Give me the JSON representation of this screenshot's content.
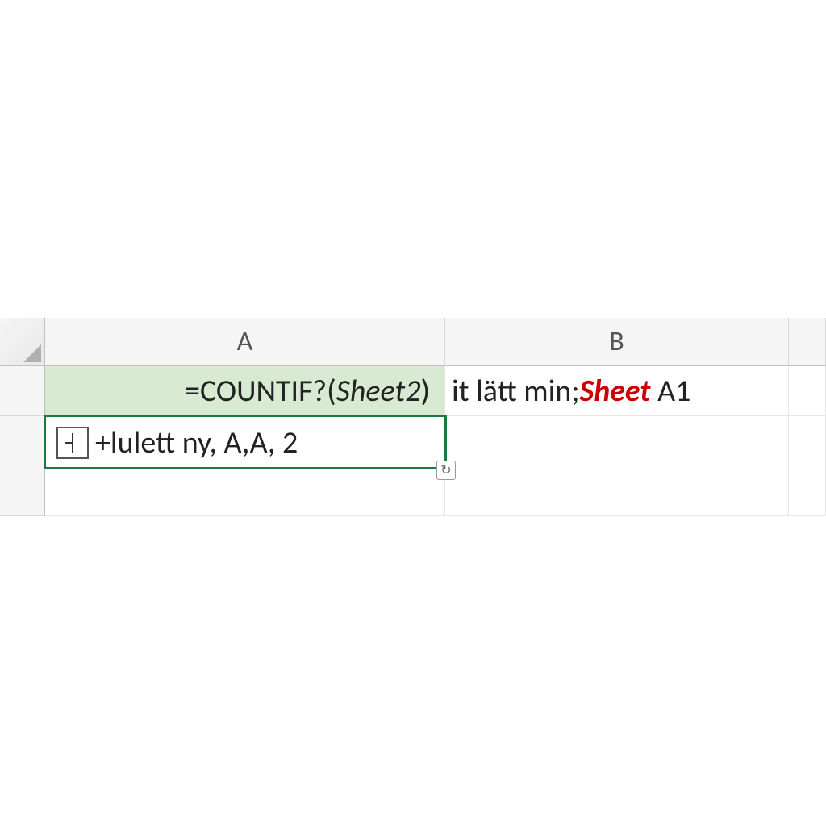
{
  "columns": {
    "a": "A",
    "b": "B"
  },
  "cells": {
    "a1": {
      "prefix": "=COUNTIF?(",
      "italic": "Sheet2",
      "suffix": ")"
    },
    "b1": {
      "prefix": "it lätt min;",
      "red": "Sheet",
      "suffix": " A1"
    },
    "a2": {
      "text": "+lulett ny, A,A, 2"
    }
  },
  "icons": {
    "edit": "text-cursor-icon",
    "smarttag": "↻"
  }
}
